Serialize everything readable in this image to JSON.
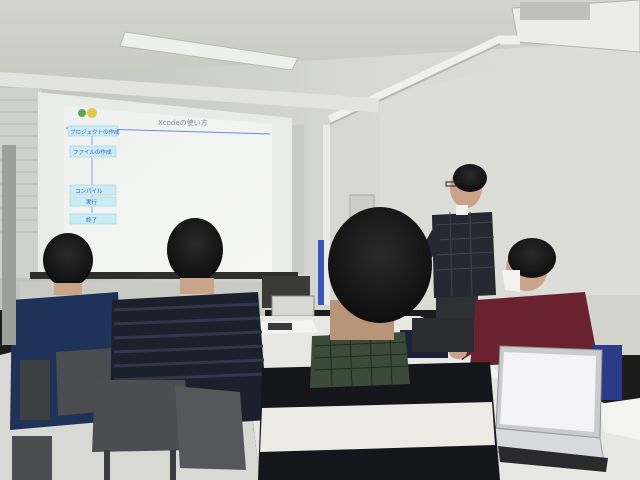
{
  "slide": {
    "title": "Xcodeの使い方",
    "steps": [
      "プロジェクトの作成",
      "ファイルの作成",
      "コンパイル",
      "実行",
      "終了"
    ]
  },
  "colors": {
    "wall": "#d6d7d1",
    "ceiling": "#cfd0ca",
    "projection": "#f2f4f1",
    "slide_button": "#c9ecf5",
    "slide_accent": "#6a8fd6"
  }
}
